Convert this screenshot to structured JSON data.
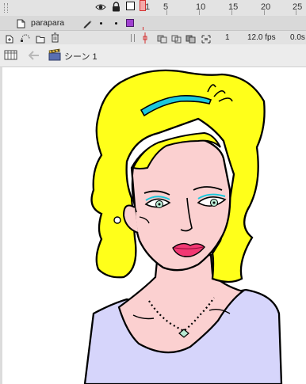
{
  "timeline": {
    "layer_name": "parapara",
    "frame_numbers": [
      "1",
      "5",
      "10",
      "15",
      "20",
      "25"
    ],
    "current_frame": "1",
    "frame_rate": "12.0 fps",
    "elapsed_time": "0.0s",
    "layer_color": "#a040d0"
  },
  "edit_bar": {
    "scene_label": "シーン 1"
  },
  "icons": {
    "eye": "eye-icon",
    "lock": "lock-icon",
    "outline": "outline-square-icon",
    "pencil": "pencil-icon",
    "insert_layer": "insert-layer-icon",
    "motion_guide": "motion-guide-icon",
    "folder": "folder-icon",
    "trash": "trash-icon",
    "back_arrow": "back-arrow-icon",
    "scene": "clapperboard-icon"
  }
}
